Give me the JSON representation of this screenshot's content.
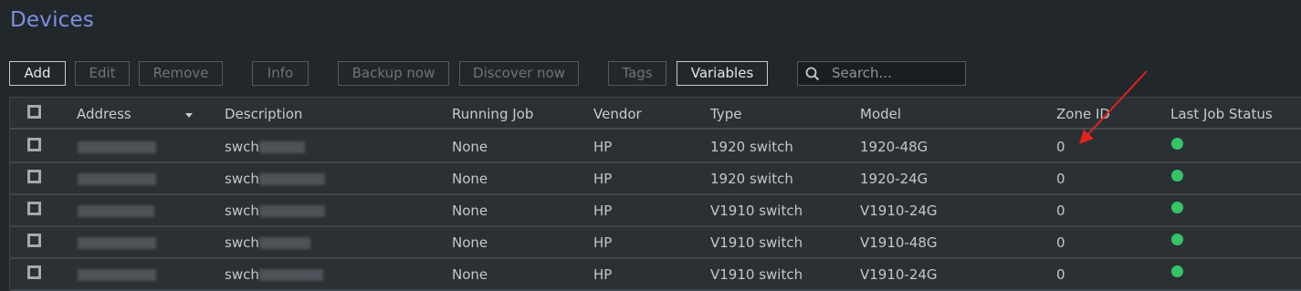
{
  "page_title": "Devices",
  "toolbar": {
    "add": "Add",
    "edit": "Edit",
    "remove": "Remove",
    "info": "Info",
    "backup_now": "Backup now",
    "discover_now": "Discover now",
    "tags": "Tags",
    "variables": "Variables"
  },
  "search": {
    "placeholder": "Search..."
  },
  "columns": {
    "address": "Address",
    "description": "Description",
    "running_job": "Running Job",
    "vendor": "Vendor",
    "type": "Type",
    "model": "Model",
    "zone_id": "Zone ID",
    "last_job_status": "Last Job Status"
  },
  "rows": [
    {
      "description_prefix": "swch",
      "running_job": "None",
      "vendor": "HP",
      "type": "1920 switch",
      "model": "1920-48G",
      "zone_id": "0",
      "status": "success"
    },
    {
      "description_prefix": "swch",
      "running_job": "None",
      "vendor": "HP",
      "type": "1920 switch",
      "model": "1920-24G",
      "zone_id": "0",
      "status": "success"
    },
    {
      "description_prefix": "swch",
      "running_job": "None",
      "vendor": "HP",
      "type": "V1910 switch",
      "model": "V1910-24G",
      "zone_id": "0",
      "status": "success"
    },
    {
      "description_prefix": "swch",
      "running_job": "None",
      "vendor": "HP",
      "type": "V1910 switch",
      "model": "V1910-48G",
      "zone_id": "0",
      "status": "success"
    },
    {
      "description_prefix": "swch",
      "running_job": "None",
      "vendor": "HP",
      "type": "V1910 switch",
      "model": "V1910-24G",
      "zone_id": "0",
      "status": "success"
    }
  ],
  "colors": {
    "title": "#7f8fe0",
    "status_success": "#35c46a",
    "annotation_arrow": "#e2241e"
  },
  "icons": {
    "search": "search-icon",
    "sort": "sort-desc-icon",
    "status": "status-dot-icon"
  }
}
